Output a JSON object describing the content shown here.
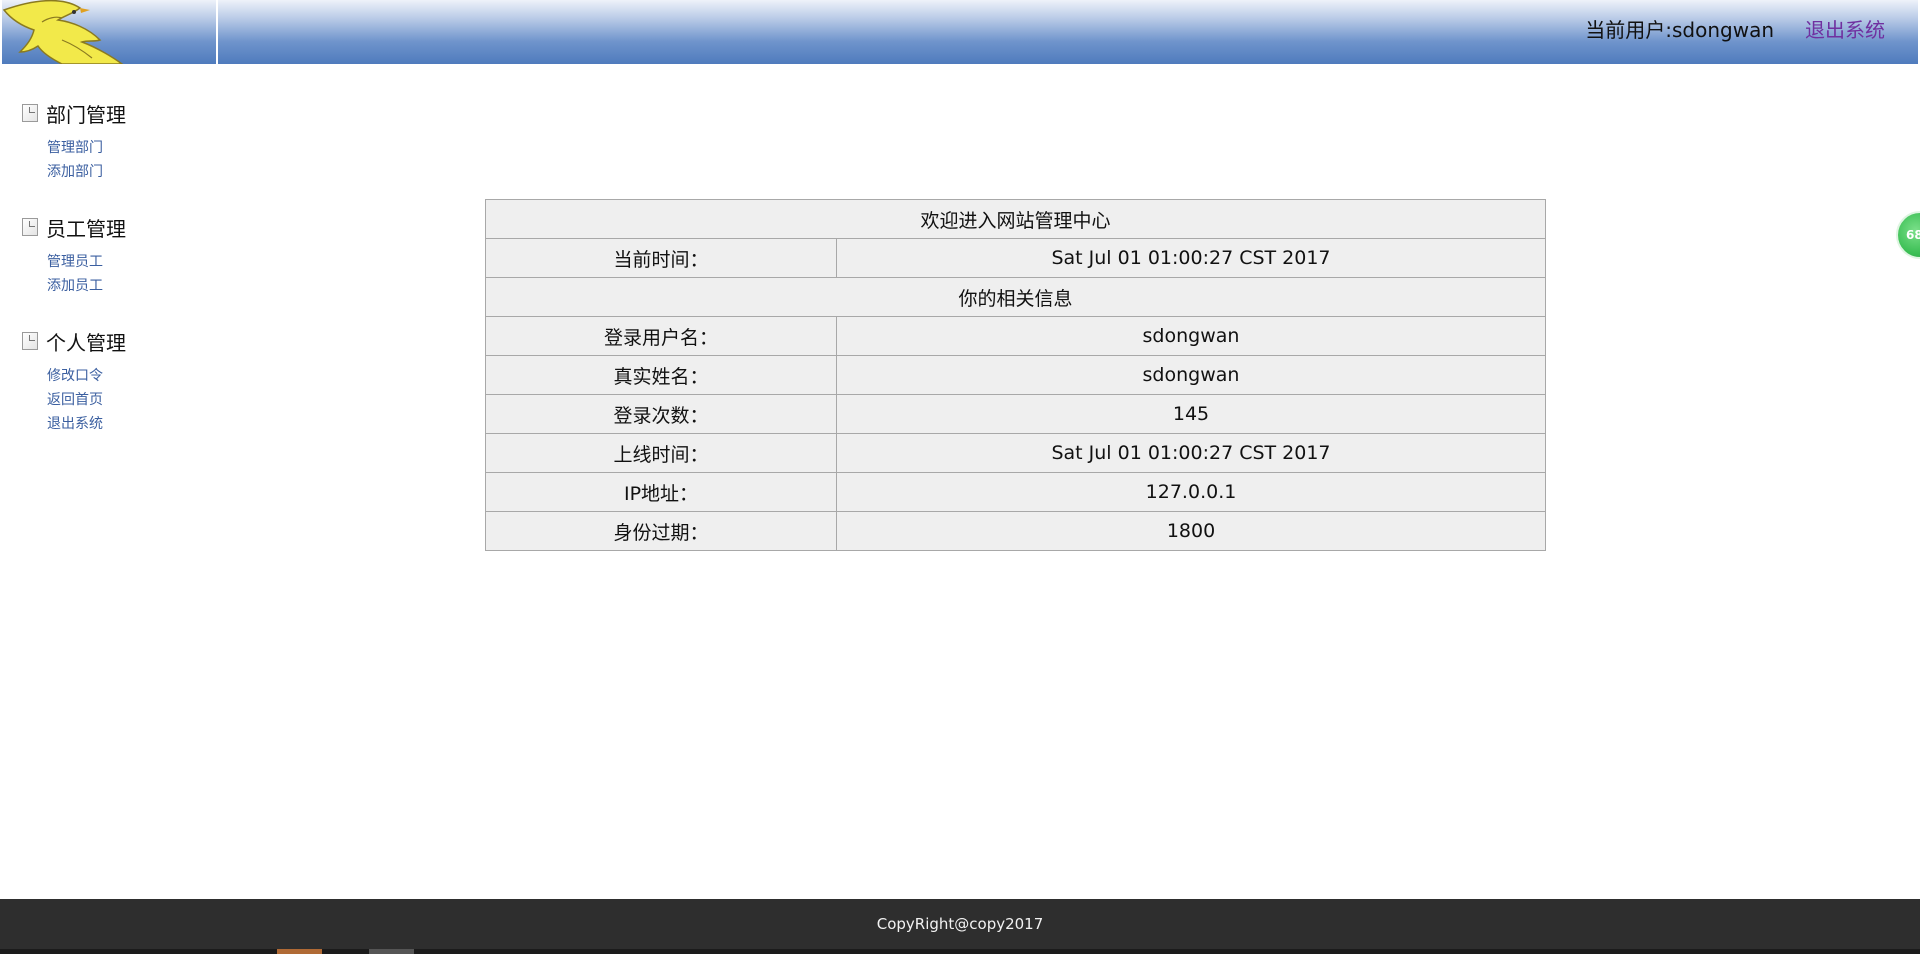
{
  "header": {
    "current_user": "当前用户:sdongwan",
    "logout": "退出系统"
  },
  "sidebar": {
    "groups": [
      {
        "title": "部门管理",
        "items": [
          "管理部门",
          "添加部门"
        ]
      },
      {
        "title": "员工管理",
        "items": [
          "管理员工",
          "添加员工"
        ]
      },
      {
        "title": "个人管理",
        "items": [
          "修改口令",
          "返回首页",
          "退出系统"
        ]
      }
    ]
  },
  "main": {
    "welcome_title": "欢迎进入网站管理中心",
    "current_time_label": "当前时间：",
    "current_time_value": "Sat Jul 01 01:00:27 CST 2017",
    "info_title": "你的相关信息",
    "rows": [
      {
        "label": "登录用户名：",
        "value": "sdongwan"
      },
      {
        "label": "真实姓名：",
        "value": "sdongwan"
      },
      {
        "label": "登录次数：",
        "value": "145"
      },
      {
        "label": "上线时间：",
        "value": "Sat Jul 01 01:00:27 CST 2017"
      },
      {
        "label": "IP地址：",
        "value": "127.0.0.1"
      },
      {
        "label": "身份过期：",
        "value": "1800"
      }
    ]
  },
  "footer": {
    "copyright": "CopyRight@copy2017"
  },
  "floating_badge": {
    "value": "68"
  },
  "colors": {
    "header_gradient_top": "#eef2fa",
    "header_gradient_bottom": "#4f7bbd",
    "logout_link": "#7030a0",
    "sidebar_link": "#3b5fa0",
    "table_bg": "#efefef",
    "footer_bg": "#2e2e2e"
  }
}
